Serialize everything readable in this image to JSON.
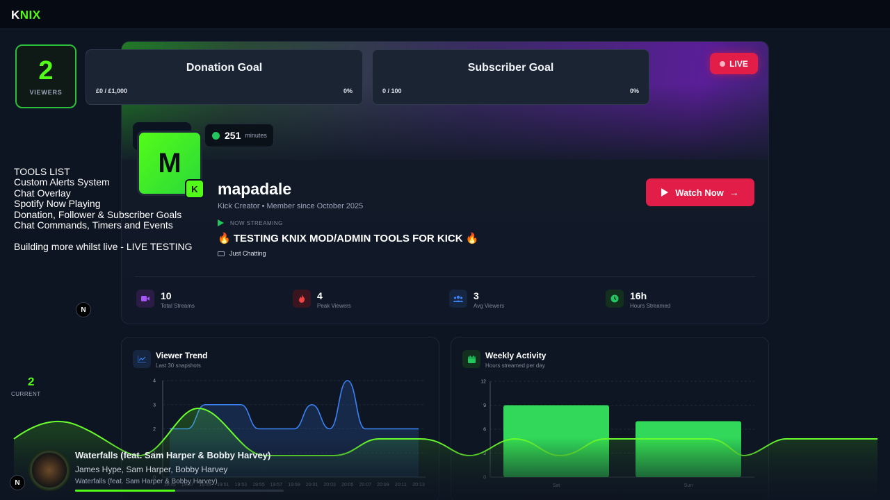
{
  "app": {
    "logo_k": "K",
    "logo_rest": "NIX"
  },
  "viewers": {
    "count": "2",
    "label": "VIEWERS"
  },
  "goals": {
    "donation": {
      "title": "Donation Goal",
      "amount": "£0 / £1,000",
      "pct": "0%"
    },
    "subscriber": {
      "title": "Subscriber Goal",
      "amount": "0 / 100",
      "pct": "0%"
    }
  },
  "live": {
    "label": "LIVE"
  },
  "profile": {
    "avatar_letter": "M",
    "kick_letter": "K",
    "minutes_value": "251",
    "minutes_unit": "minutes",
    "username": "mapadale",
    "subline": "Kick Creator • Member since October 2025",
    "now_streaming": "NOW STREAMING",
    "stream_title": "🔥 TESTING KNIX MOD/ADMIN TOOLS FOR KICK 🔥",
    "category": "Just Chatting",
    "watch_label": "Watch Now",
    "watch_arrow": "→"
  },
  "stats": [
    {
      "value": "10",
      "label": "Total Streams",
      "color": "#a855f7"
    },
    {
      "value": "4",
      "label": "Peak Viewers",
      "color": "#ef4444"
    },
    {
      "value": "3",
      "label": "Avg Viewers",
      "color": "#3b82f6"
    },
    {
      "value": "16h",
      "label": "Hours Streamed",
      "color": "#22c55e"
    }
  ],
  "tools": {
    "lines": [
      "TOOLS LIST",
      "Custom Alerts System",
      "Chat Overlay",
      "Spotify Now Playing",
      "Donation, Follower & Subscriber Goals",
      "Chat Commands, Timers and Events",
      "",
      "Building more whilst live - LIVE TESTING"
    ]
  },
  "n_badge": "N",
  "viewer_trend": {
    "title": "Viewer Trend",
    "subtitle": "Last 30 snapshots"
  },
  "weekly_activity": {
    "title": "Weekly Activity",
    "subtitle": "Hours streamed per day"
  },
  "current": {
    "value": "2",
    "label": "CURRENT"
  },
  "music": {
    "title": "Waterfalls (feat. Sam Harper & Bobby Harvey)",
    "artist": "James Hype, Sam Harper, Bobby Harvey",
    "album": "Waterfalls (feat. Sam Harper & Bobby Harvey)",
    "progress": 0.48
  },
  "chart_data": [
    {
      "type": "area",
      "title": "Viewer Trend",
      "subtitle": "Last 30 snapshots",
      "ylim": [
        0,
        4
      ],
      "yticks": [
        0,
        1,
        2,
        3,
        4
      ],
      "x": [
        "19:45",
        "19:47",
        "19:49",
        "19:51",
        "19:53",
        "19:55",
        "19:57",
        "19:59",
        "20:01",
        "20:03",
        "20:05",
        "20:07",
        "20:09",
        "20:11",
        "20:13"
      ],
      "values": [
        2,
        2,
        3,
        3,
        3,
        2,
        2,
        2,
        3,
        2,
        4,
        2,
        2,
        2,
        2
      ],
      "grid": true,
      "color": "#3b82f6"
    },
    {
      "type": "bar",
      "title": "Weekly Activity",
      "subtitle": "Hours streamed per day",
      "categories": [
        "Sat",
        "Sun"
      ],
      "values": [
        9,
        7
      ],
      "ylim": [
        0,
        12
      ],
      "yticks": [
        0,
        3,
        6,
        9,
        12
      ],
      "grid": true,
      "color": "#31d85a"
    }
  ]
}
